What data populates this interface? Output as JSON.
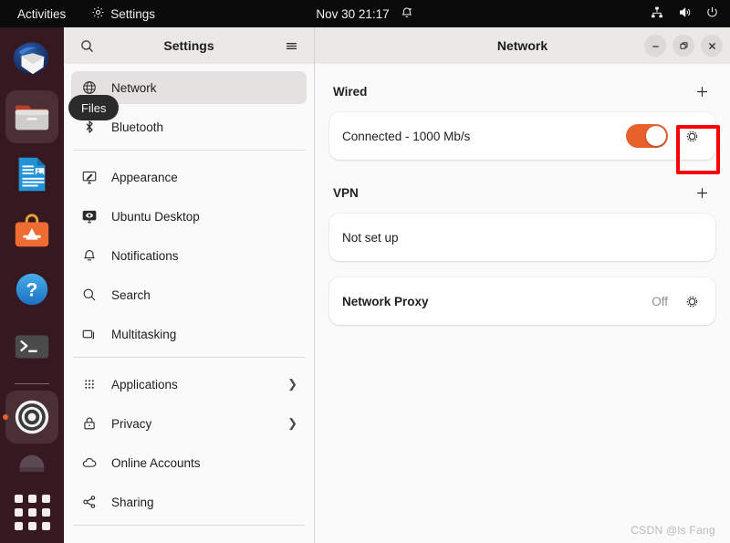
{
  "topbar": {
    "activities": "Activities",
    "app_name": "Settings",
    "app_icon": "gear-icon",
    "clock": "Nov 30  21:17",
    "notification_icon": "bell-icon",
    "status_icons": [
      "network-wired-icon",
      "volume-icon",
      "power-icon"
    ]
  },
  "dock": {
    "items": [
      {
        "name": "thunderbird",
        "icon": "thunderbird-icon",
        "active": false
      },
      {
        "name": "files",
        "icon": "files-icon",
        "active": false,
        "hovered": true
      },
      {
        "name": "libreoffice-writer",
        "icon": "writer-icon",
        "active": false
      },
      {
        "name": "ubuntu-software",
        "icon": "software-icon",
        "active": false
      },
      {
        "name": "help",
        "icon": "help-icon",
        "active": false
      },
      {
        "name": "terminal",
        "icon": "terminal-icon",
        "active": false
      },
      {
        "name": "settings",
        "icon": "settings-gear-icon",
        "active": true
      },
      {
        "name": "trash",
        "icon": "trash-icon",
        "active": false
      }
    ],
    "tooltip": "Files",
    "show_apps_label": "Show Applications"
  },
  "sidebar": {
    "title": "Settings",
    "search_icon": "search-icon",
    "menu_icon": "hamburger-menu-icon",
    "items": [
      {
        "label": "Network",
        "icon": "network-icon",
        "selected": true,
        "chevron": false
      },
      {
        "label": "Bluetooth",
        "icon": "bluetooth-icon",
        "selected": false,
        "chevron": false
      },
      {
        "label": "Appearance",
        "icon": "appearance-icon",
        "selected": false,
        "chevron": false
      },
      {
        "label": "Ubuntu Desktop",
        "icon": "ubuntu-desktop-icon",
        "selected": false,
        "chevron": false
      },
      {
        "label": "Notifications",
        "icon": "notifications-icon",
        "selected": false,
        "chevron": false
      },
      {
        "label": "Search",
        "icon": "search-icon",
        "selected": false,
        "chevron": false
      },
      {
        "label": "Multitasking",
        "icon": "multitasking-icon",
        "selected": false,
        "chevron": false
      },
      {
        "label": "Applications",
        "icon": "applications-icon",
        "selected": false,
        "chevron": true
      },
      {
        "label": "Privacy",
        "icon": "privacy-lock-icon",
        "selected": false,
        "chevron": true
      },
      {
        "label": "Online Accounts",
        "icon": "online-accounts-icon",
        "selected": false,
        "chevron": false
      },
      {
        "label": "Sharing",
        "icon": "sharing-icon",
        "selected": false,
        "chevron": false
      }
    ]
  },
  "window": {
    "title": "Network",
    "controls": {
      "minimize": "minimize-icon",
      "maximize": "maximize-icon",
      "close": "close-icon"
    }
  },
  "network_page": {
    "sections": [
      {
        "title": "Wired",
        "add_label": "+",
        "rows": [
          {
            "label": "Connected - 1000 Mb/s",
            "bold": false,
            "toggle": true,
            "toggle_on": true,
            "status": null,
            "gear": true,
            "highlighted": true
          }
        ]
      },
      {
        "title": "VPN",
        "add_label": "+",
        "rows": [
          {
            "label": "Not set up",
            "bold": false,
            "toggle": false,
            "toggle_on": false,
            "status": null,
            "gear": false,
            "highlighted": false
          }
        ]
      },
      {
        "title": null,
        "add_label": null,
        "rows": [
          {
            "label": "Network Proxy",
            "bold": true,
            "toggle": false,
            "toggle_on": false,
            "status": "Off",
            "gear": true,
            "highlighted": false
          }
        ]
      }
    ]
  },
  "annotation": {
    "color": "#fb0104",
    "target": "wired-connection-settings-gear"
  },
  "watermark": "CSDN @ls Fang",
  "colors": {
    "accent_orange": "#e8602c",
    "topbar_bg": "#0b0b0c",
    "dock_bg": "#2e0f18",
    "window_bg": "#fafafa",
    "titlebar_bg": "#ebe9e7",
    "selected_row": "#e4e1de",
    "annotation_red": "#fb0104"
  }
}
